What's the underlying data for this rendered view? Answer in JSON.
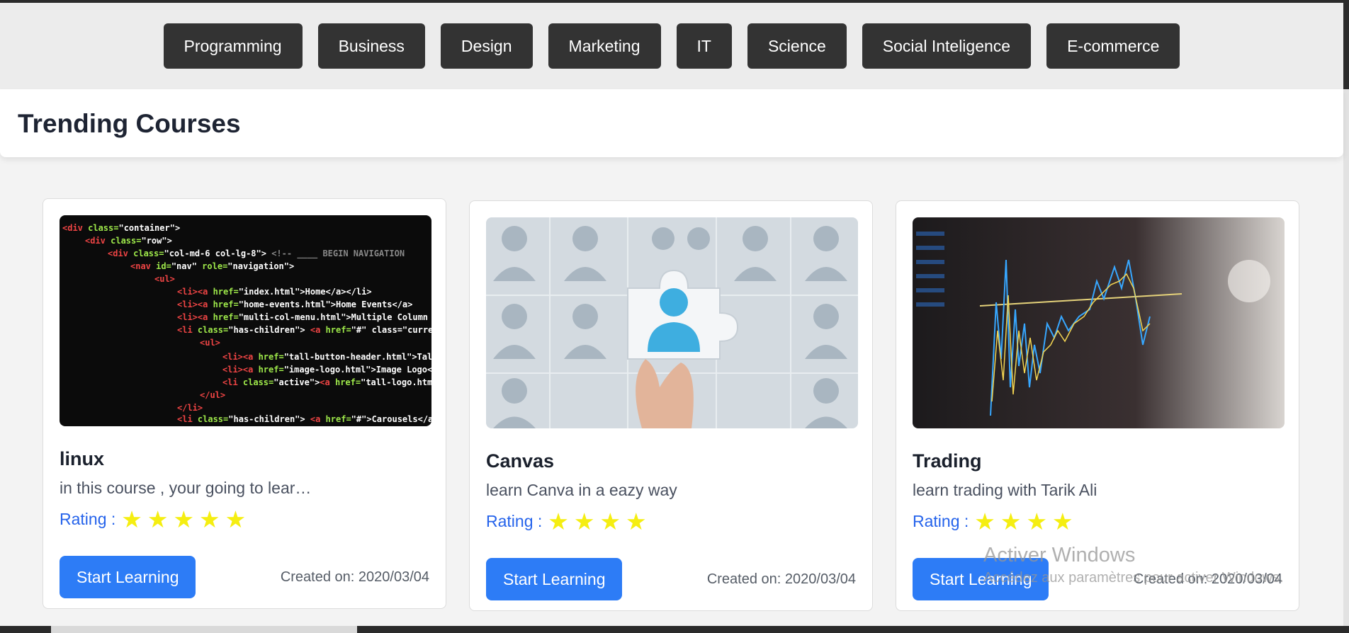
{
  "categories": [
    {
      "label": "Programming"
    },
    {
      "label": "Business"
    },
    {
      "label": "Design"
    },
    {
      "label": "Marketing"
    },
    {
      "label": "IT"
    },
    {
      "label": "Science"
    },
    {
      "label": "Social Inteligence"
    },
    {
      "label": "E-commerce"
    }
  ],
  "section": {
    "title": "Trending Courses"
  },
  "courses": [
    {
      "title": "linux",
      "description": "in this course , your going to lear…",
      "rating_label": "Rating :",
      "stars": 5,
      "button_label": "Start Learning",
      "created": "Created on: 2020/03/04",
      "image": "code-editor-image"
    },
    {
      "title": "Canvas",
      "description": "learn Canva in a eazy way",
      "rating_label": "Rating :",
      "stars": 4,
      "button_label": "Start Learning",
      "created": "Created on: 2020/03/04",
      "image": "puzzle-piece-image"
    },
    {
      "title": "Trading",
      "description": "learn trading with Tarik Ali",
      "rating_label": "Rating :",
      "stars": 4,
      "button_label": "Start Learning",
      "created": "Created on: 2020/03/04",
      "image": "stock-chart-image"
    }
  ],
  "watermark": {
    "title": "Activer Windows",
    "subtitle": "Accédez aux paramètres pour activer Windows."
  },
  "colors": {
    "nav_button": "#333333",
    "primary_button": "#2d7cf6",
    "rating_label": "#2563eb",
    "star": "#f5ee11"
  },
  "icons": {
    "star": "star-icon"
  }
}
